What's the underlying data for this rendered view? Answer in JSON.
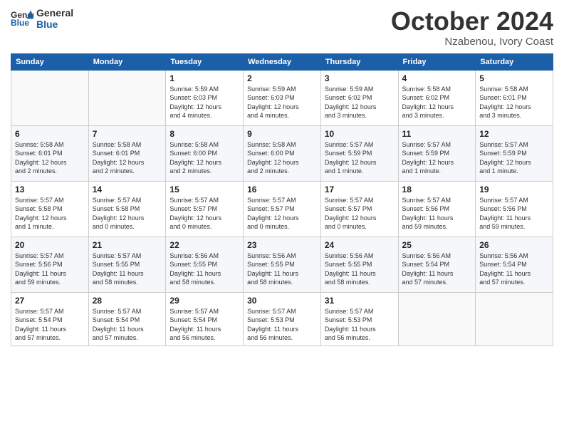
{
  "header": {
    "logo_line1": "General",
    "logo_line2": "Blue",
    "month": "October 2024",
    "location": "Nzabenou, Ivory Coast"
  },
  "weekdays": [
    "Sunday",
    "Monday",
    "Tuesday",
    "Wednesday",
    "Thursday",
    "Friday",
    "Saturday"
  ],
  "weeks": [
    [
      {
        "day": "",
        "info": ""
      },
      {
        "day": "",
        "info": ""
      },
      {
        "day": "1",
        "info": "Sunrise: 5:59 AM\nSunset: 6:03 PM\nDaylight: 12 hours\nand 4 minutes."
      },
      {
        "day": "2",
        "info": "Sunrise: 5:59 AM\nSunset: 6:03 PM\nDaylight: 12 hours\nand 4 minutes."
      },
      {
        "day": "3",
        "info": "Sunrise: 5:59 AM\nSunset: 6:02 PM\nDaylight: 12 hours\nand 3 minutes."
      },
      {
        "day": "4",
        "info": "Sunrise: 5:58 AM\nSunset: 6:02 PM\nDaylight: 12 hours\nand 3 minutes."
      },
      {
        "day": "5",
        "info": "Sunrise: 5:58 AM\nSunset: 6:01 PM\nDaylight: 12 hours\nand 3 minutes."
      }
    ],
    [
      {
        "day": "6",
        "info": "Sunrise: 5:58 AM\nSunset: 6:01 PM\nDaylight: 12 hours\nand 2 minutes."
      },
      {
        "day": "7",
        "info": "Sunrise: 5:58 AM\nSunset: 6:01 PM\nDaylight: 12 hours\nand 2 minutes."
      },
      {
        "day": "8",
        "info": "Sunrise: 5:58 AM\nSunset: 6:00 PM\nDaylight: 12 hours\nand 2 minutes."
      },
      {
        "day": "9",
        "info": "Sunrise: 5:58 AM\nSunset: 6:00 PM\nDaylight: 12 hours\nand 2 minutes."
      },
      {
        "day": "10",
        "info": "Sunrise: 5:57 AM\nSunset: 5:59 PM\nDaylight: 12 hours\nand 1 minute."
      },
      {
        "day": "11",
        "info": "Sunrise: 5:57 AM\nSunset: 5:59 PM\nDaylight: 12 hours\nand 1 minute."
      },
      {
        "day": "12",
        "info": "Sunrise: 5:57 AM\nSunset: 5:59 PM\nDaylight: 12 hours\nand 1 minute."
      }
    ],
    [
      {
        "day": "13",
        "info": "Sunrise: 5:57 AM\nSunset: 5:58 PM\nDaylight: 12 hours\nand 1 minute."
      },
      {
        "day": "14",
        "info": "Sunrise: 5:57 AM\nSunset: 5:58 PM\nDaylight: 12 hours\nand 0 minutes."
      },
      {
        "day": "15",
        "info": "Sunrise: 5:57 AM\nSunset: 5:57 PM\nDaylight: 12 hours\nand 0 minutes."
      },
      {
        "day": "16",
        "info": "Sunrise: 5:57 AM\nSunset: 5:57 PM\nDaylight: 12 hours\nand 0 minutes."
      },
      {
        "day": "17",
        "info": "Sunrise: 5:57 AM\nSunset: 5:57 PM\nDaylight: 12 hours\nand 0 minutes."
      },
      {
        "day": "18",
        "info": "Sunrise: 5:57 AM\nSunset: 5:56 PM\nDaylight: 11 hours\nand 59 minutes."
      },
      {
        "day": "19",
        "info": "Sunrise: 5:57 AM\nSunset: 5:56 PM\nDaylight: 11 hours\nand 59 minutes."
      }
    ],
    [
      {
        "day": "20",
        "info": "Sunrise: 5:57 AM\nSunset: 5:56 PM\nDaylight: 11 hours\nand 59 minutes."
      },
      {
        "day": "21",
        "info": "Sunrise: 5:57 AM\nSunset: 5:55 PM\nDaylight: 11 hours\nand 58 minutes."
      },
      {
        "day": "22",
        "info": "Sunrise: 5:56 AM\nSunset: 5:55 PM\nDaylight: 11 hours\nand 58 minutes."
      },
      {
        "day": "23",
        "info": "Sunrise: 5:56 AM\nSunset: 5:55 PM\nDaylight: 11 hours\nand 58 minutes."
      },
      {
        "day": "24",
        "info": "Sunrise: 5:56 AM\nSunset: 5:55 PM\nDaylight: 11 hours\nand 58 minutes."
      },
      {
        "day": "25",
        "info": "Sunrise: 5:56 AM\nSunset: 5:54 PM\nDaylight: 11 hours\nand 57 minutes."
      },
      {
        "day": "26",
        "info": "Sunrise: 5:56 AM\nSunset: 5:54 PM\nDaylight: 11 hours\nand 57 minutes."
      }
    ],
    [
      {
        "day": "27",
        "info": "Sunrise: 5:57 AM\nSunset: 5:54 PM\nDaylight: 11 hours\nand 57 minutes."
      },
      {
        "day": "28",
        "info": "Sunrise: 5:57 AM\nSunset: 5:54 PM\nDaylight: 11 hours\nand 57 minutes."
      },
      {
        "day": "29",
        "info": "Sunrise: 5:57 AM\nSunset: 5:54 PM\nDaylight: 11 hours\nand 56 minutes."
      },
      {
        "day": "30",
        "info": "Sunrise: 5:57 AM\nSunset: 5:53 PM\nDaylight: 11 hours\nand 56 minutes."
      },
      {
        "day": "31",
        "info": "Sunrise: 5:57 AM\nSunset: 5:53 PM\nDaylight: 11 hours\nand 56 minutes."
      },
      {
        "day": "",
        "info": ""
      },
      {
        "day": "",
        "info": ""
      }
    ]
  ]
}
